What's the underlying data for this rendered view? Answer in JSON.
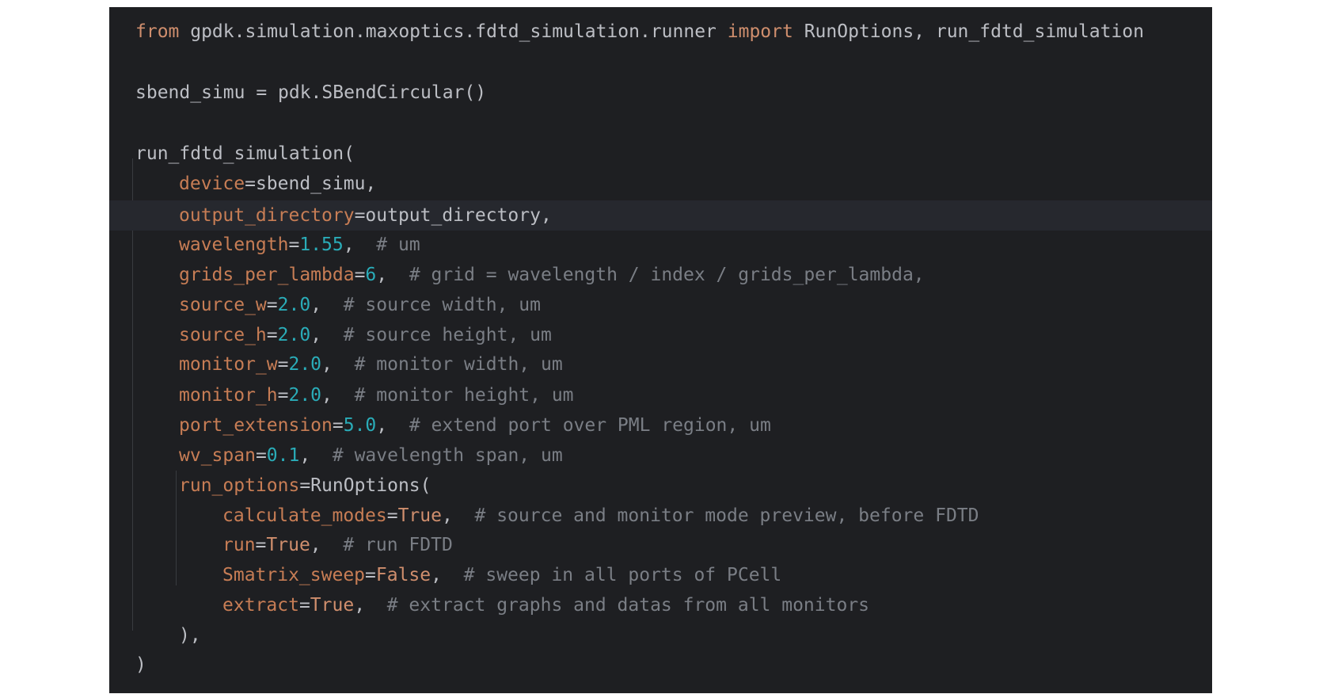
{
  "colors": {
    "background": "#1e1f22",
    "current_line": "#26282e",
    "default_text": "#bcbec4",
    "keyword": "#cf8e6d",
    "parameter": "#c77d55",
    "number": "#2aacb8",
    "comment": "#7a7e85"
  },
  "code": {
    "line_import": {
      "kw_from": "from",
      "module": " gpdk.simulation.maxoptics.fdtd_simulation.runner ",
      "kw_import": "import",
      "names": " RunOptions, run_fdtd_simulation"
    },
    "line_assign": {
      "text": "sbend_simu = pdk.SBendCircular()"
    },
    "line_call_open": {
      "text": "run_fdtd_simulation("
    },
    "line_device": {
      "param": "device",
      "rest": "=sbend_simu,"
    },
    "line_output_dir": {
      "param": "output_directory",
      "rest": "=output_directory,"
    },
    "line_wavelength": {
      "param": "wavelength",
      "eq": "=",
      "value": "1.55",
      "sep": ",  ",
      "comment": "# um"
    },
    "line_grids": {
      "param": "grids_per_lambda",
      "eq": "=",
      "value": "6",
      "sep": ",  ",
      "comment": "# grid = wavelength / index / grids_per_lambda,"
    },
    "line_source_w": {
      "param": "source_w",
      "eq": "=",
      "value": "2.0",
      "sep": ",  ",
      "comment": "# source width, um"
    },
    "line_source_h": {
      "param": "source_h",
      "eq": "=",
      "value": "2.0",
      "sep": ",  ",
      "comment": "# source height, um"
    },
    "line_monitor_w": {
      "param": "monitor_w",
      "eq": "=",
      "value": "2.0",
      "sep": ",  ",
      "comment": "# monitor width, um"
    },
    "line_monitor_h": {
      "param": "monitor_h",
      "eq": "=",
      "value": "2.0",
      "sep": ",  ",
      "comment": "# monitor height, um"
    },
    "line_port_ext": {
      "param": "port_extension",
      "eq": "=",
      "value": "5.0",
      "sep": ",  ",
      "comment": "# extend port over PML region, um"
    },
    "line_wv_span": {
      "param": "wv_span",
      "eq": "=",
      "value": "0.1",
      "sep": ",  ",
      "comment": "# wavelength span, um"
    },
    "line_run_options": {
      "param": "run_options",
      "rest": "=RunOptions("
    },
    "line_calc_modes": {
      "param": "calculate_modes",
      "eq": "=",
      "value": "True",
      "sep": ",  ",
      "comment": "# source and monitor mode preview, before FDTD"
    },
    "line_run": {
      "param": "run",
      "eq": "=",
      "value": "True",
      "sep": ",  ",
      "comment": "# run FDTD"
    },
    "line_smatrix": {
      "param": "Smatrix_sweep",
      "eq": "=",
      "value": "False",
      "sep": ",  ",
      "comment": "# sweep in all ports of PCell"
    },
    "line_extract": {
      "param": "extract",
      "eq": "=",
      "value": "True",
      "sep": ",  ",
      "comment": "# extract graphs and datas from all monitors"
    },
    "line_inner_close": {
      "text": "),"
    },
    "line_outer_close": {
      "text": ")"
    }
  }
}
